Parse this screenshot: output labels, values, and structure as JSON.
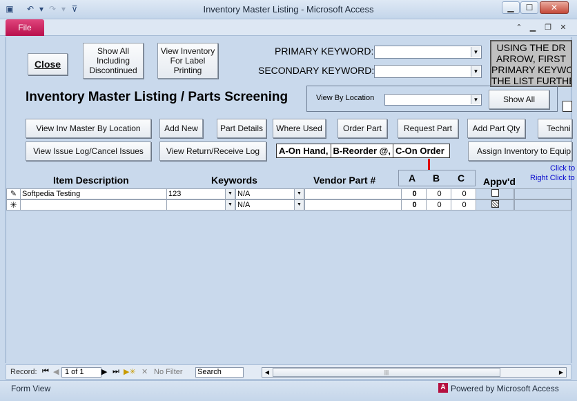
{
  "window": {
    "title": "Inventory Master Listing  -  Microsoft Access",
    "file_tab": "File"
  },
  "header": {
    "close_label": "Close",
    "show_all_discontinued": "Show All Including Discontinued",
    "view_label_printing": "View Inventory For Label Printing",
    "primary_keyword_label": "PRIMARY KEYWORD:",
    "secondary_keyword_label": "SECONDARY KEYWORD:",
    "primary_keyword_value": "",
    "secondary_keyword_value": "",
    "instruction_lines": [
      "USING THE DR",
      "ARROW, FIRST",
      "PRIMARY KEYWO",
      "THE LIST FURTHE"
    ],
    "form_title": "Inventory Master Listing / Parts Screening",
    "view_by_location_label": "View By Location",
    "view_by_location_value": "",
    "show_all_label": "Show All"
  },
  "toolbar_row1": [
    "View Inv Master By Location",
    "Add New",
    "Part Details",
    "Where Used",
    "Order Part",
    "Request Part",
    "Add Part Qty",
    "Techni"
  ],
  "toolbar_row2": {
    "issue_log": "View Issue Log/Cancel Issues",
    "return_log": "View Return/Receive Log",
    "legend_a": "A-On Hand,",
    "legend_b": "B-Reorder @,",
    "legend_c": "C-On Order",
    "assign": "Assign Inventory to Equipme"
  },
  "columns": {
    "item_description": "Item Description",
    "keywords": "Keywords",
    "vendor_part": "Vendor Part #",
    "a": "A",
    "b": "B",
    "c": "C",
    "approved": "Appv'd",
    "click_hint": "Click to",
    "right_click_hint": "Right Click to"
  },
  "rows": [
    {
      "marker": "pencil-icon",
      "description": "Softpedia Testing",
      "keyword1": "123",
      "keyword2": "N/A",
      "vendor_part": "",
      "a": "0",
      "b": "0",
      "c": "0"
    },
    {
      "marker": "new-record-icon",
      "description": "",
      "keyword1": "",
      "keyword2": "N/A",
      "vendor_part": "",
      "a": "0",
      "b": "0",
      "c": "0"
    }
  ],
  "navigation": {
    "record_label": "Record:",
    "position": "1 of 1",
    "no_filter": "No Filter",
    "search": "Search"
  },
  "status": {
    "mode": "Form View",
    "powered_by": "Powered by Microsoft Access"
  },
  "colors": {
    "form_background": "#c9d9ec",
    "file_tab": "#c8175a",
    "hint_text": "#0000cc",
    "divider_red": "#e00000"
  }
}
